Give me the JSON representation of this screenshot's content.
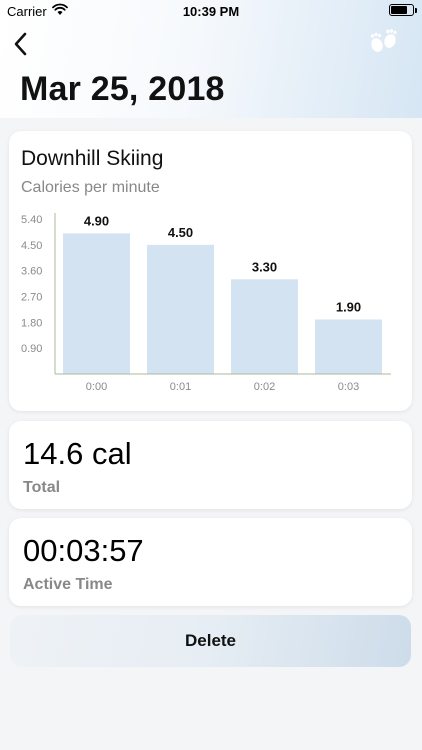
{
  "status_bar": {
    "carrier": "Carrier",
    "time": "10:39 PM",
    "icons": [
      "wifi-icon",
      "battery-icon"
    ]
  },
  "nav": {
    "back_icon": "chevron-left-icon",
    "activity_icon": "footprints-icon"
  },
  "date_title": "Mar 25, 2018",
  "chart_card": {
    "title": "Downhill Skiing",
    "subtitle": "Calories per minute"
  },
  "chart_data": {
    "type": "bar",
    "title": "Downhill Skiing",
    "subtitle": "Calories per minute",
    "categories": [
      "0:00",
      "0:01",
      "0:02",
      "0:03"
    ],
    "values": [
      4.9,
      4.5,
      3.3,
      1.9
    ],
    "value_labels": [
      "4.90",
      "4.50",
      "3.30",
      "1.90"
    ],
    "y_ticks": [
      "5.40",
      "4.50",
      "3.60",
      "2.70",
      "1.80",
      "0.90"
    ],
    "y_tick_values": [
      5.4,
      4.5,
      3.6,
      2.7,
      1.8,
      0.9
    ],
    "ylim": [
      0,
      5.4
    ],
    "xlabel": "",
    "ylabel": "",
    "grid": false,
    "bar_color": "#d3e3f2",
    "axis_color": "#a9b89a"
  },
  "total": {
    "value": "14.6 cal",
    "label": "Total"
  },
  "active_time": {
    "value": "00:03:57",
    "label": "Active Time"
  },
  "delete_button": {
    "label": "Delete"
  }
}
